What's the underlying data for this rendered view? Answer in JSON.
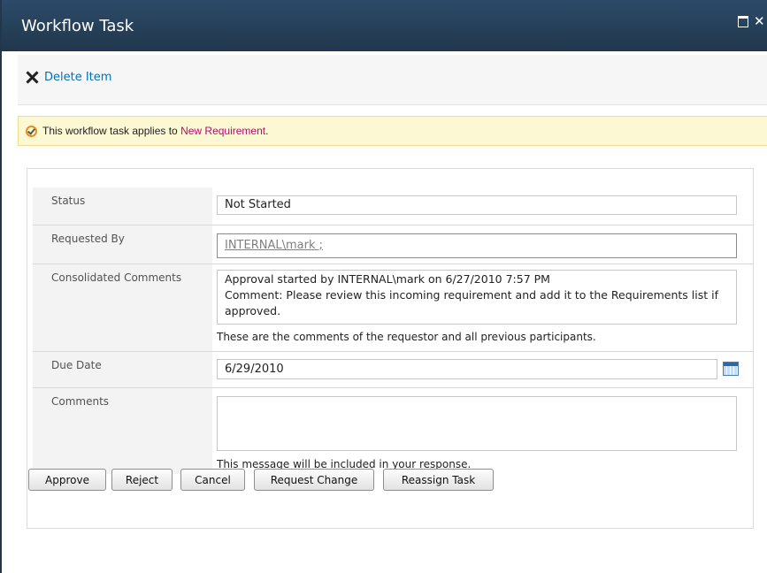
{
  "window": {
    "title": "Workflow Task"
  },
  "ribbon": {
    "delete_label": "Delete Item"
  },
  "notice": {
    "prefix": "This workflow task applies to ",
    "link": "New Requirement",
    "suffix": "."
  },
  "form": {
    "status": {
      "label": "Status",
      "value": "Not Started"
    },
    "requested_by": {
      "label": "Requested By",
      "value": "INTERNAL\\mark",
      "separator": " ;"
    },
    "consolidated_comments": {
      "label": "Consolidated Comments",
      "line1": "Approval started by INTERNAL\\mark on 6/27/2010 7:57 PM",
      "line2": "Comment: Please review this incoming requirement and add it to the Requirements list if approved.",
      "help": "These are the comments of the requestor and all previous participants."
    },
    "due_date": {
      "label": "Due Date",
      "value": "6/29/2010",
      "icon": "calendar-icon"
    },
    "comments": {
      "label": "Comments",
      "value": "",
      "help": "This message will be included in your response."
    }
  },
  "buttons": {
    "approve": "Approve",
    "reject": "Reject",
    "cancel": "Cancel",
    "request_change": "Request Change",
    "reassign_task": "Reassign Task"
  },
  "colors": {
    "titlebar": "#21374c",
    "link": "#0072bc",
    "notice_link": "#b10e6d",
    "notice_bg": "#fdf8d4"
  }
}
